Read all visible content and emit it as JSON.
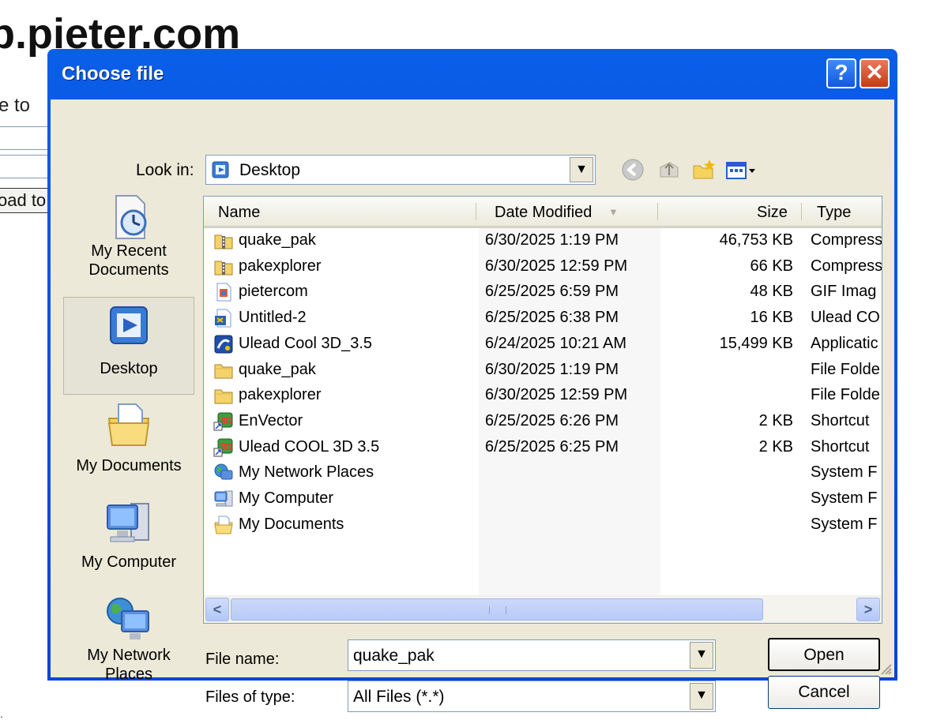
{
  "background_page": {
    "title": "p.pieter.com",
    "label": "e to",
    "button": "oad to",
    "footer_mark": "."
  },
  "dialog": {
    "title": "Choose file",
    "help_glyph": "?",
    "close_glyph": "✕",
    "look_in": {
      "label": "Look in:",
      "value": "Desktop"
    },
    "toolbar_icons": [
      "back-icon",
      "up-folder-icon",
      "new-folder-icon",
      "view-menu-icon"
    ],
    "places": [
      {
        "name": "recent",
        "label": "My Recent Documents",
        "lines": [
          "My Recent",
          "Documents"
        ]
      },
      {
        "name": "desktop",
        "label": "Desktop",
        "lines": [
          "Desktop"
        ],
        "selected": true
      },
      {
        "name": "mydocs",
        "label": "My Documents",
        "lines": [
          "My Documents"
        ]
      },
      {
        "name": "mycomputer",
        "label": "My Computer",
        "lines": [
          "My Computer"
        ]
      },
      {
        "name": "network",
        "label": "My Network Places",
        "lines": [
          "My Network",
          "Places"
        ]
      }
    ],
    "columns": {
      "name": "Name",
      "date": "Date Modified",
      "size": "Size",
      "type": "Type",
      "sorted_by": "Date Modified"
    },
    "files": [
      {
        "name": "quake_pak",
        "date": "6/30/2025 1:19 PM",
        "size": "46,753 KB",
        "type": "Compress",
        "icon": "zip-folder-icon"
      },
      {
        "name": "pakexplorer",
        "date": "6/30/2025 12:59 PM",
        "size": "66 KB",
        "type": "Compress",
        "icon": "zip-folder-icon"
      },
      {
        "name": "pietercom",
        "date": "6/25/2025 6:59 PM",
        "size": "48 KB",
        "type": "GIF Imag",
        "icon": "gif-image-icon"
      },
      {
        "name": "Untitled-2",
        "date": "6/25/2025 6:38 PM",
        "size": "16 KB",
        "type": "Ulead CO",
        "icon": "ulead-document-icon"
      },
      {
        "name": "Ulead Cool 3D_3.5",
        "date": "6/24/2025 10:21 AM",
        "size": "15,499 KB",
        "type": "Applicatic",
        "icon": "application-icon"
      },
      {
        "name": "quake_pak",
        "date": "6/30/2025 1:19 PM",
        "size": "",
        "type": "File Folde",
        "icon": "folder-icon"
      },
      {
        "name": "pakexplorer",
        "date": "6/30/2025 12:59 PM",
        "size": "",
        "type": "File Folde",
        "icon": "folder-icon"
      },
      {
        "name": "EnVector",
        "date": "6/25/2025 6:26 PM",
        "size": "2 KB",
        "type": "Shortcut",
        "icon": "shortcut-icon"
      },
      {
        "name": "Ulead COOL 3D 3.5",
        "date": "6/25/2025 6:25 PM",
        "size": "2 KB",
        "type": "Shortcut",
        "icon": "shortcut-icon"
      },
      {
        "name": "My Network Places",
        "date": "",
        "size": "",
        "type": "System F",
        "icon": "network-places-icon"
      },
      {
        "name": "My Computer",
        "date": "",
        "size": "",
        "type": "System F",
        "icon": "my-computer-icon"
      },
      {
        "name": "My Documents",
        "date": "",
        "size": "",
        "type": "System F",
        "icon": "my-documents-icon"
      }
    ],
    "file_name": {
      "label": "File name:",
      "value": "quake_pak"
    },
    "file_type": {
      "label": "Files of type:",
      "value": "All Files (*.*)"
    },
    "open_button": "Open",
    "cancel_button": "Cancel",
    "scroll_left_glyph": "<",
    "scroll_right_glyph": ">",
    "dropdown_glyph": "▼",
    "sort_glyph": "▼"
  }
}
